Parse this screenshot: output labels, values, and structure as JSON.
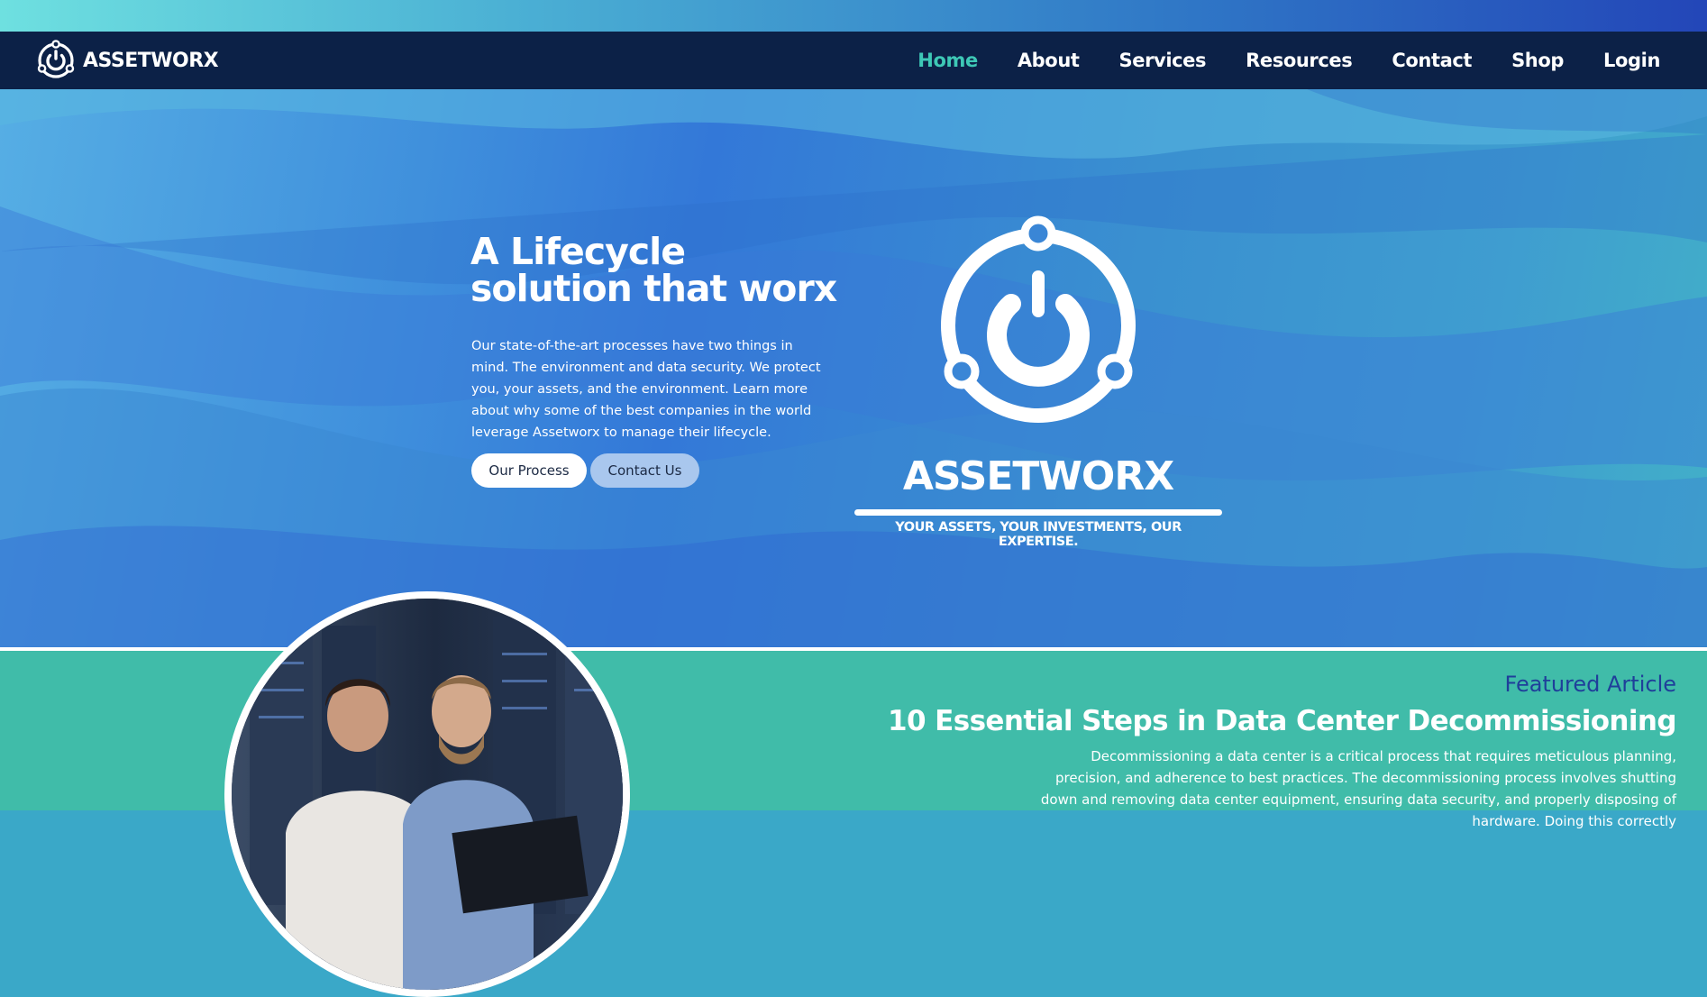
{
  "brand": {
    "name": "ASSETWORX",
    "logo_icon": "power-ring-logo-icon"
  },
  "nav": {
    "items": [
      {
        "label": "Home",
        "active": true
      },
      {
        "label": "About"
      },
      {
        "label": "Services"
      },
      {
        "label": "Resources"
      },
      {
        "label": "Contact"
      },
      {
        "label": "Shop"
      },
      {
        "label": "Login"
      }
    ]
  },
  "hero": {
    "title_line1": "A Lifecycle",
    "title_line2": "solution that worx",
    "text": "Our state-of-the-art processes have two things in mind. The environment and data security. We protect you, your assets, and the environment. Learn more about why some of the best companies in the world leverage Assetworx to manage their lifecycle.",
    "buttons": {
      "process": "Our Process",
      "contact": "Contact Us"
    },
    "brand_name": "ASSETWORX",
    "tagline": "YOUR ASSETS, YOUR INVESTMENTS, OUR EXPERTISE."
  },
  "featured": {
    "kicker": "Featured Article",
    "title": "10 Essential Steps in Data Center Decommissioning",
    "excerpt": "Decommissioning a data center is a critical process that requires meticulous planning, precision, and adherence to best practices. The decommissioning process involves shutting down and removing data center equipment, ensuring data security, and properly disposing of hardware. Doing this correctly"
  },
  "colors": {
    "nav_bg": "#0c2147",
    "nav_active": "#3ec8b6",
    "featured_bg": "#40bca9",
    "kicker": "#1f3f9a",
    "contact_btn": "#a9c7ee"
  }
}
